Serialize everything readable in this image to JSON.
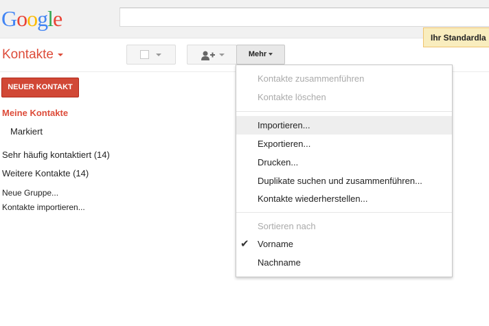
{
  "google_logo": "Google",
  "notice_text": "Ihr Standardla",
  "app": {
    "title": "Kontakte"
  },
  "toolbar": {
    "more_label": "Mehr"
  },
  "sidebar": {
    "new_contact_label": "NEUER KONTAKT",
    "my_contacts": "Meine Kontakte",
    "starred": "Markiert",
    "most_contacted": "Sehr häufig kontaktiert (14)",
    "other_contacts": "Weitere Kontakte (14)",
    "new_group": "Neue Gruppe...",
    "import_contacts": "Kontakte importieren..."
  },
  "menu": {
    "merge": "Kontakte zusammenführen",
    "delete": "Kontakte löschen",
    "import": "Importieren...",
    "export": "Exportieren...",
    "print": "Drucken...",
    "find_duplicates": "Duplikate suchen und zusammenführen...",
    "restore": "Kontakte wiederherstellen...",
    "sort_by": "Sortieren nach",
    "first_name": "Vorname",
    "last_name": "Nachname"
  },
  "colors": {
    "brand_red": "#dd4b39",
    "button_red": "#d14836",
    "notice_bg": "#f9edbe"
  }
}
